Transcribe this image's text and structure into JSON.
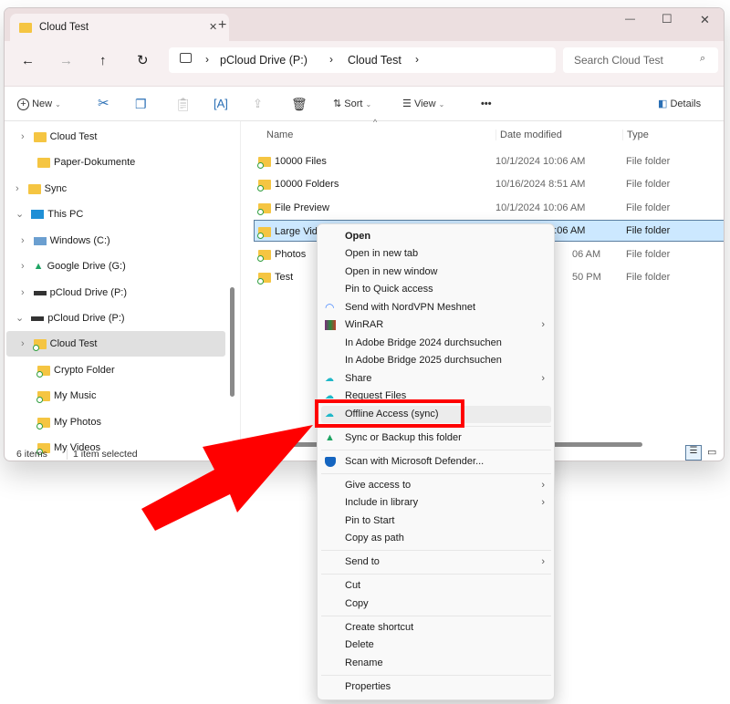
{
  "window": {
    "tab_title": "Cloud Test",
    "close_tab": "✕",
    "new_tab": "+",
    "minimize": "—",
    "maximize": "☐",
    "close": "✕"
  },
  "address": {
    "breadcrumbs": [
      "pCloud Drive (P:)",
      "Cloud Test"
    ],
    "search_placeholder": "Search Cloud Test"
  },
  "toolbar": {
    "new": "New",
    "sort": "Sort",
    "view": "View",
    "more": "•••",
    "details": "Details"
  },
  "sidebar": [
    {
      "label": "Cloud Test",
      "expander": ">"
    },
    {
      "label": "Paper-Dokumente",
      "expander": ""
    },
    {
      "label": "Sync",
      "expander": ">"
    },
    {
      "label": "This PC",
      "expander": "v"
    },
    {
      "label": "Windows (C:)",
      "expander": ">"
    },
    {
      "label": "Google Drive (G:)",
      "expander": ">"
    },
    {
      "label": "pCloud Drive (P:)",
      "expander": ">"
    },
    {
      "label": "pCloud Drive (P:)",
      "expander": "v"
    },
    {
      "label": "Cloud Test",
      "expander": ">"
    },
    {
      "label": "Crypto Folder",
      "expander": ""
    },
    {
      "label": "My Music",
      "expander": ""
    },
    {
      "label": "My Photos",
      "expander": ""
    },
    {
      "label": "My Videos",
      "expander": ""
    }
  ],
  "columns": {
    "name": "Name",
    "date": "Date modified",
    "type": "Type"
  },
  "files": [
    {
      "name": "10000 Files",
      "date": "10/1/2024 10:06 AM",
      "type": "File folder"
    },
    {
      "name": "10000 Folders",
      "date": "10/16/2024 8:51 AM",
      "type": "File folder"
    },
    {
      "name": "File Preview",
      "date": "10/1/2024 10:06 AM",
      "type": "File folder"
    },
    {
      "name": "Large Video",
      "date": "10/1/2024 10:06 AM",
      "type": "File folder"
    },
    {
      "name": "Photos",
      "date": "06 AM",
      "type": "File folder"
    },
    {
      "name": "Test",
      "date": "50 PM",
      "type": "File folder"
    }
  ],
  "status": {
    "count": "6 items",
    "selected": "1 item selected"
  },
  "menu": [
    "Open",
    "Open in new tab",
    "Open in new window",
    "Pin to Quick access",
    "Send with NordVPN Meshnet",
    "WinRAR",
    "In Adobe Bridge 2024 durchsuchen",
    "In Adobe Bridge 2025 durchsuchen",
    "Share",
    "Request Files",
    "Offline Access (sync)",
    "Sync or Backup this folder",
    "Scan with Microsoft Defender...",
    "Give access to",
    "Include in library",
    "Pin to Start",
    "Copy as path",
    "Send to",
    "Cut",
    "Copy",
    "Create shortcut",
    "Delete",
    "Rename",
    "Properties"
  ],
  "colors": {
    "highlight": "#ff0000",
    "selection": "#cce8ff",
    "accent": "#0067c0"
  }
}
